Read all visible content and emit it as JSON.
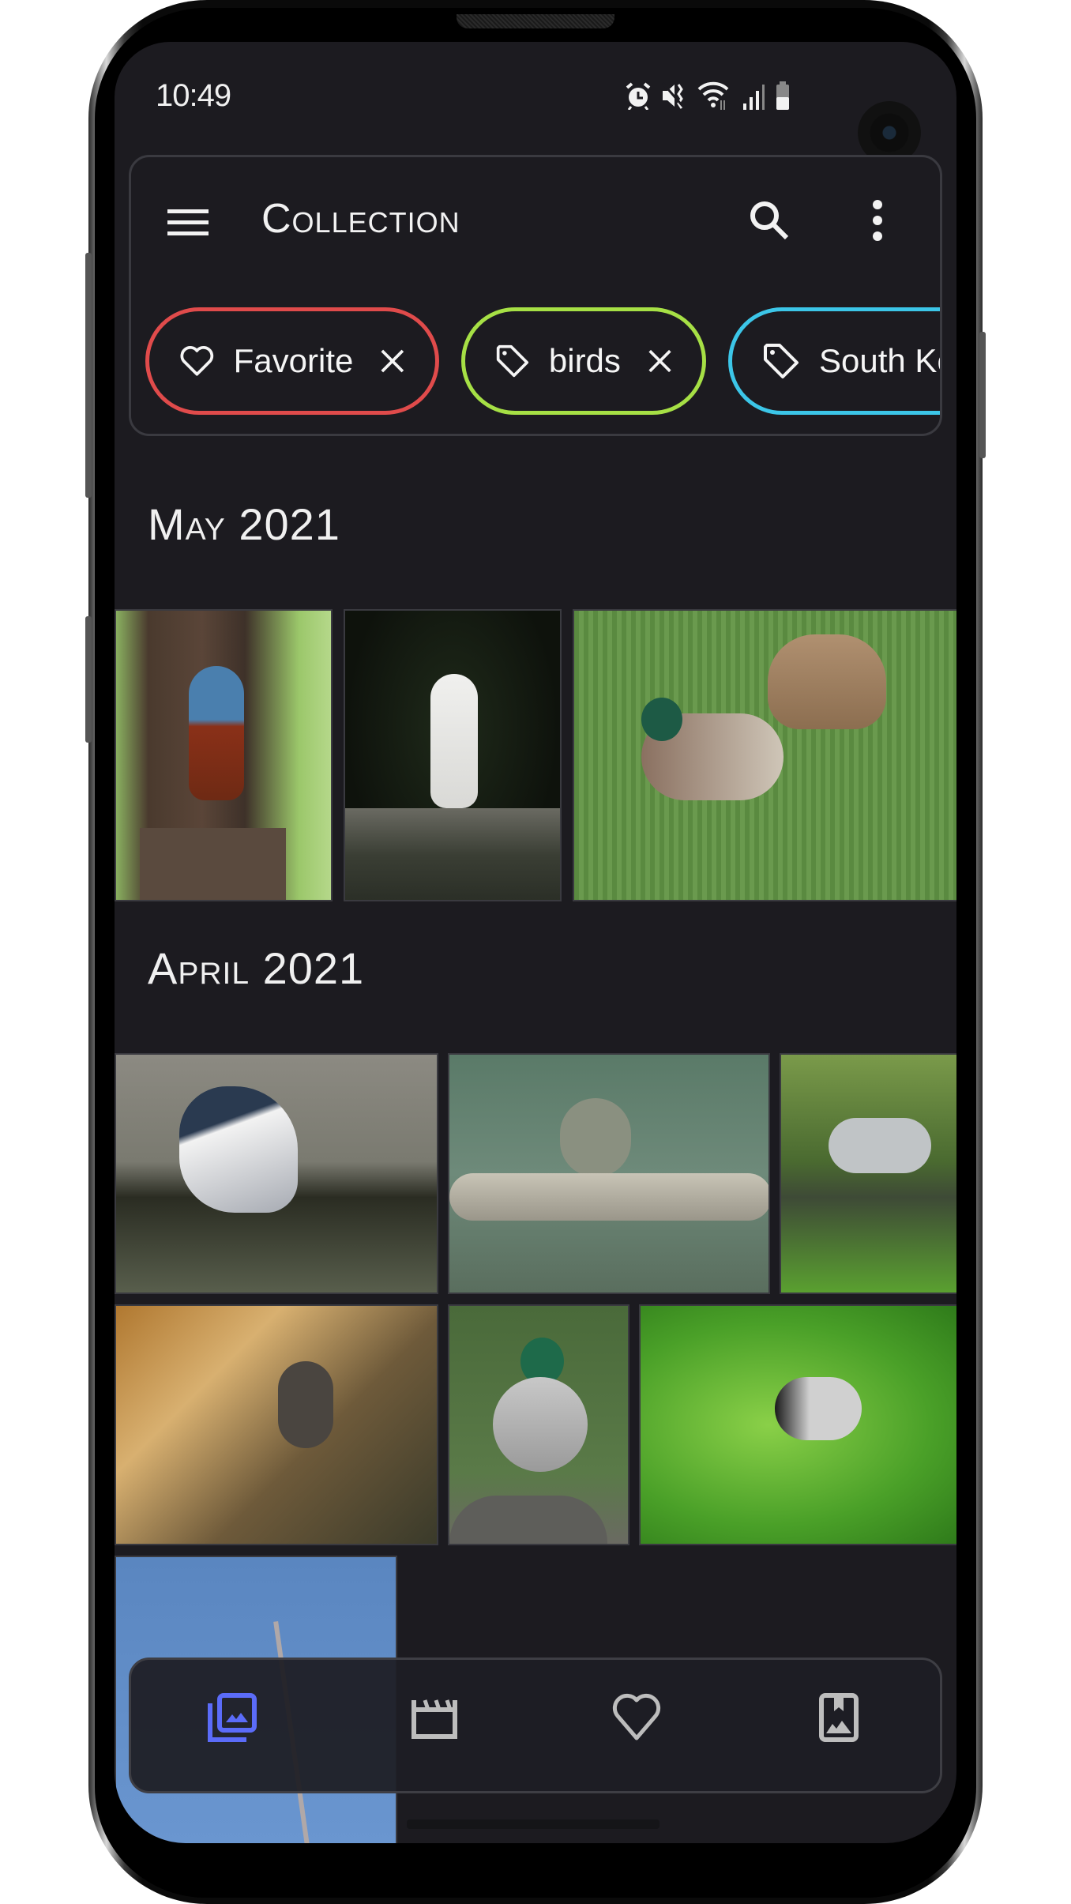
{
  "status_bar": {
    "time": "10:49",
    "icons": [
      "alarm-icon",
      "mute-vibrate-icon",
      "wifi-icon",
      "signal-icon",
      "battery-icon"
    ]
  },
  "app_bar": {
    "title": "Collection",
    "menu_icon": "hamburger-menu-icon",
    "search_icon": "search-icon",
    "more_icon": "more-vert-icon"
  },
  "filters": [
    {
      "label": "Favorite",
      "icon": "heart-outline-icon",
      "color": "#e04b4b",
      "removable": true
    },
    {
      "label": "birds",
      "icon": "tag-icon",
      "color": "#a6e045",
      "removable": true
    },
    {
      "label": "South Korea",
      "icon": "tag-icon",
      "color": "#3cc6e8",
      "removable": false
    }
  ],
  "sections": [
    {
      "title": "May 2021",
      "photos": [
        {
          "subject": "blue rock thrush on wooden post"
        },
        {
          "subject": "great egret on rock"
        },
        {
          "subject": "mallard ducks in water"
        }
      ]
    },
    {
      "title": "April 2021",
      "photos": [
        {
          "subject": "black-crowned night heron"
        },
        {
          "subject": "bird on branch with prey"
        },
        {
          "subject": "grey heron in grass"
        },
        {
          "subject": "bird among autumn leaves"
        },
        {
          "subject": "mallard on rock"
        },
        {
          "subject": "tit on cherry branch"
        },
        {
          "subject": "branch against blue sky"
        }
      ]
    }
  ],
  "bottom_nav": {
    "items": [
      {
        "name": "collection",
        "icon": "photo-library-icon",
        "active": true
      },
      {
        "name": "videos",
        "icon": "movie-clapper-icon",
        "active": false
      },
      {
        "name": "favorites",
        "icon": "heart-outline-icon",
        "active": false
      },
      {
        "name": "albums",
        "icon": "photo-album-icon",
        "active": false
      }
    ],
    "active_color": "#5b6cf9",
    "inactive_color": "#bdbdbd"
  }
}
